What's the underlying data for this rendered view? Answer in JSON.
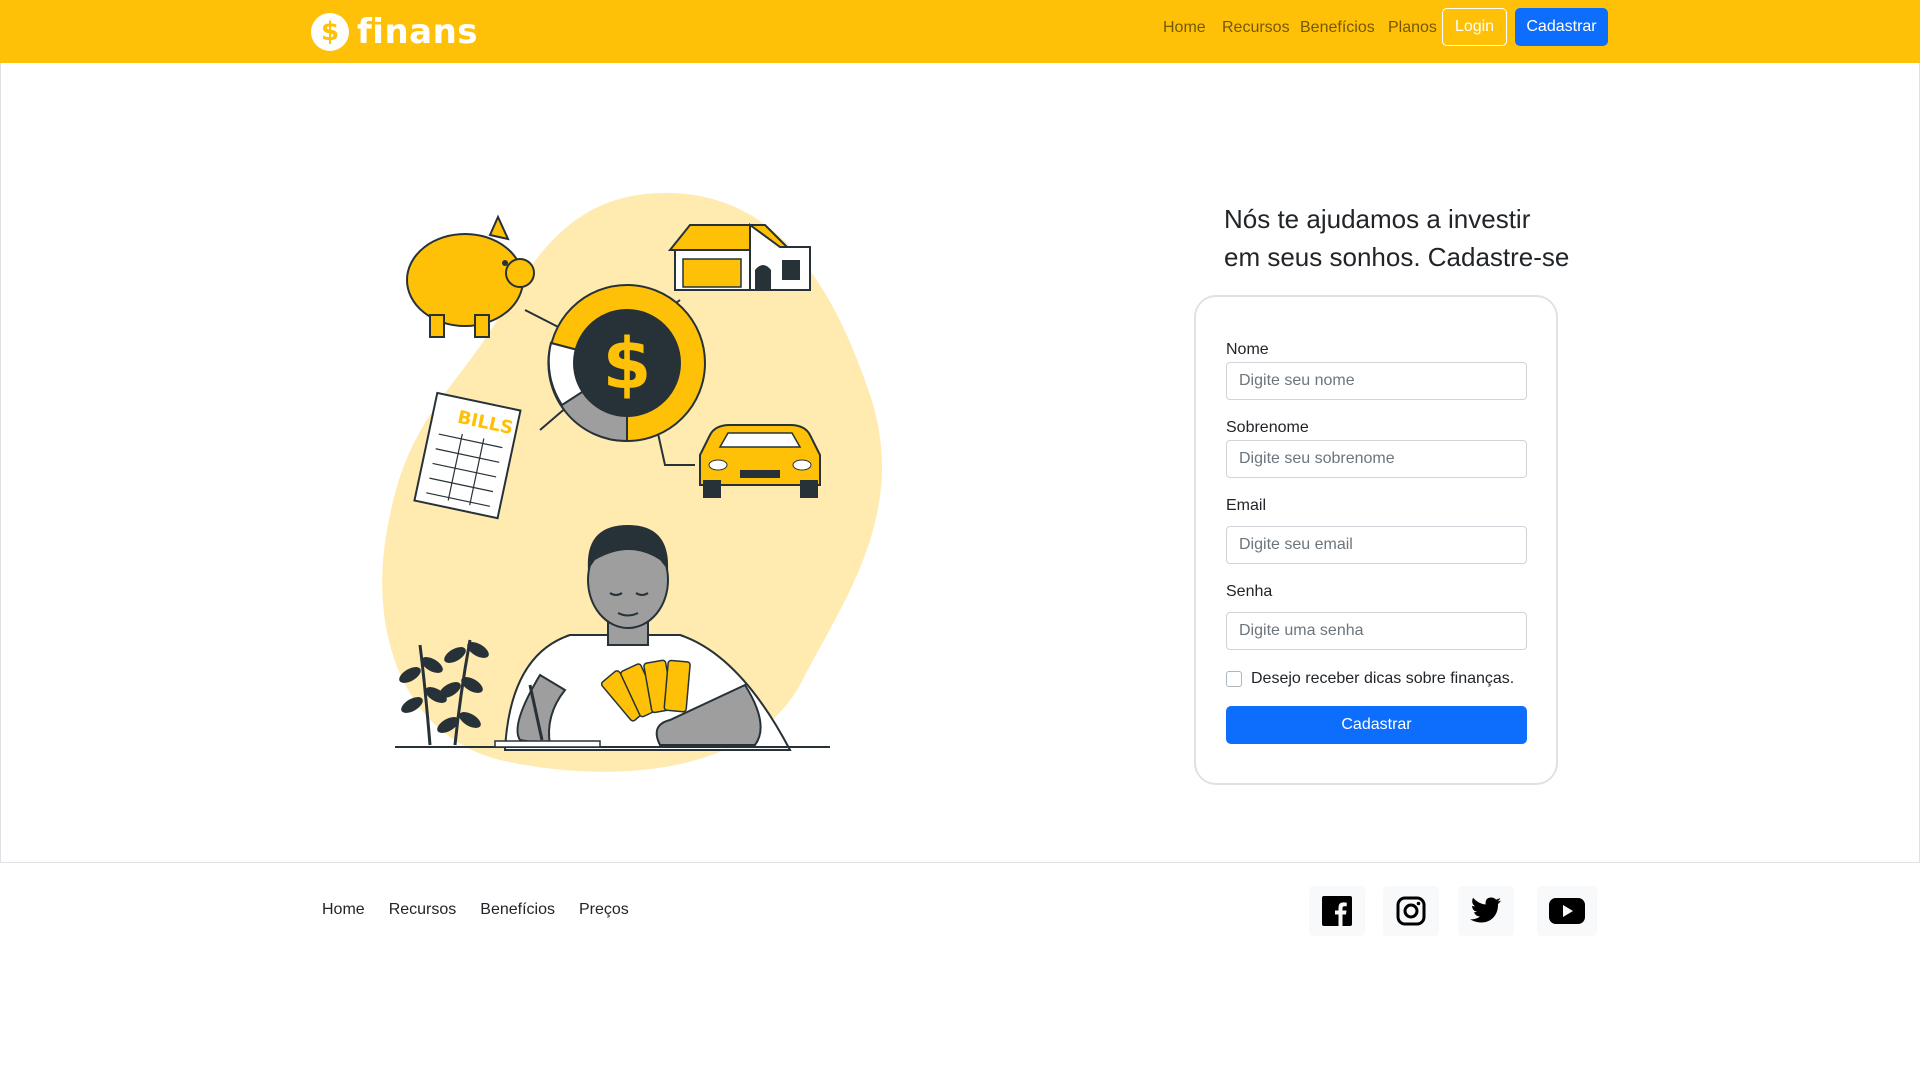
{
  "brand": {
    "name": "finans",
    "logo_glyph": "$",
    "logo_icon": "dollar-coin-icon"
  },
  "colors": {
    "brand_yellow": "#ffc107",
    "primary_blue": "#0d6efd",
    "white": "#ffffff"
  },
  "nav": {
    "items": [
      "Home",
      "Recursos",
      "Benefícios",
      "Planos"
    ],
    "login_label": "Login",
    "cadastrar_label": "Cadastrar"
  },
  "illustration": {
    "bills_label": "BILLS",
    "coin_glyph": "$"
  },
  "main": {
    "headline_line1": "Nós te ajudamos a investir",
    "headline_line2": "em seus sonhos. Cadastre-se"
  },
  "form": {
    "nome": {
      "label": "Nome",
      "placeholder": "Digite seu nome"
    },
    "sobrenome": {
      "label": "Sobrenome",
      "placeholder": "Digite seu sobrenome"
    },
    "email": {
      "label": "Email",
      "placeholder": "Digite seu email"
    },
    "senha": {
      "label": "Senha",
      "placeholder": "Digite uma senha"
    },
    "checkbox_label": "Desejo receber dicas sobre finanças.",
    "checkbox_checked": false,
    "submit_label": "Cadastrar"
  },
  "footer": {
    "links": [
      "Home",
      "Recursos",
      "Benefícios",
      "Preços"
    ],
    "social_icons": [
      "facebook-icon",
      "instagram-icon",
      "twitter-icon",
      "youtube-icon"
    ]
  }
}
